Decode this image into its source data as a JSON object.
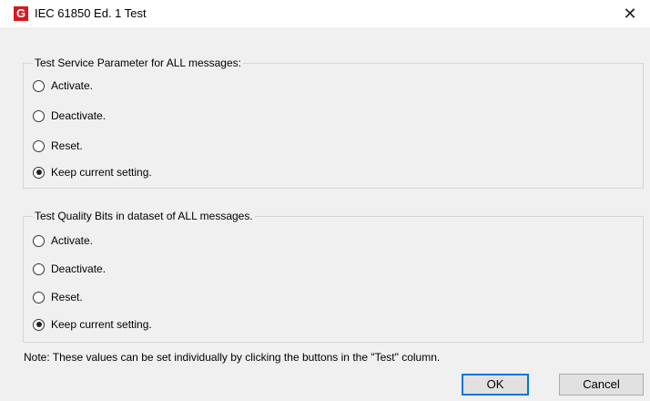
{
  "window": {
    "icon_letter": "G",
    "title": "IEC 61850 Ed. 1 Test",
    "close_glyph": "✕"
  },
  "groups": [
    {
      "title": "Test Service Parameter for ALL messages:",
      "options": [
        {
          "label": "Activate.",
          "checked": false
        },
        {
          "label": "Deactivate.",
          "checked": false
        },
        {
          "label": "Reset.",
          "checked": false
        },
        {
          "label": "Keep current setting.",
          "checked": true
        }
      ]
    },
    {
      "title": "Test Quality Bits in dataset of ALL messages.",
      "options": [
        {
          "label": "Activate.",
          "checked": false
        },
        {
          "label": "Deactivate.",
          "checked": false
        },
        {
          "label": "Reset.",
          "checked": false
        },
        {
          "label": "Keep current setting.",
          "checked": true
        }
      ]
    }
  ],
  "note": "Note:  These values can be set individually by clicking the buttons in the \"Test\" column.",
  "buttons": {
    "ok": "OK",
    "cancel": "Cancel"
  },
  "colors": {
    "app_icon": "#d71920",
    "default_button_border": "#0078d7"
  }
}
